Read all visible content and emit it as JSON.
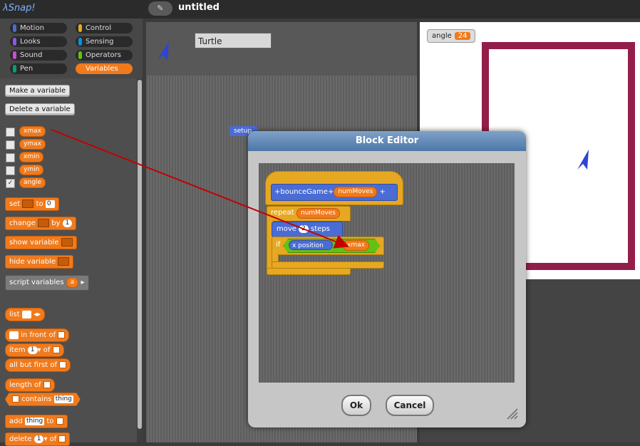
{
  "app": {
    "logo": "λSnap!",
    "project_title": "untitled",
    "cloud_icon": "pencil-icon"
  },
  "categories": [
    {
      "label": "Motion",
      "color": "#4a6cd4"
    },
    {
      "label": "Control",
      "color": "#e6a822"
    },
    {
      "label": "Looks",
      "color": "#8f56e3"
    },
    {
      "label": "Sensing",
      "color": "#0494dc"
    },
    {
      "label": "Sound",
      "color": "#cf4ad9"
    },
    {
      "label": "Operators",
      "color": "#62c213"
    },
    {
      "label": "Pen",
      "color": "#00a178"
    },
    {
      "label": "Variables",
      "color": "#f07a1c"
    }
  ],
  "palette": {
    "make_variable": "Make a variable",
    "delete_variable": "Delete a variable",
    "variables": [
      {
        "name": "xmax",
        "checked": false
      },
      {
        "name": "ymax",
        "checked": false
      },
      {
        "name": "xmin",
        "checked": false
      },
      {
        "name": "ymin",
        "checked": false
      },
      {
        "name": "angle",
        "checked": true
      }
    ],
    "set_label": "set",
    "set_to": "to",
    "set_value": "0",
    "change_label": "change",
    "change_by": "by",
    "change_value": "1",
    "show_variable": "show variable",
    "hide_variable": "hide variable",
    "script_variables": "script variables",
    "script_var_name": "a",
    "list_label": "list",
    "in_front_of": "in front of",
    "item_label": "item",
    "item_value": "1",
    "item_of": "of",
    "all_but_first": "all but first of",
    "length_of": "length of",
    "contains": "contains",
    "contains_value": "thing",
    "add_label": "add",
    "add_value": "thing",
    "add_to": "to",
    "delete_label": "delete",
    "delete_value": "1",
    "delete_of": "of"
  },
  "sprite": {
    "name": "Turtle"
  },
  "script": {
    "setup_block": "setup"
  },
  "stage": {
    "watcher_label": "angle",
    "watcher_value": "24"
  },
  "block_editor": {
    "title": "Block Editor",
    "hat_name": "bounceGame",
    "hat_param": "numMoves",
    "repeat_label": "repeat",
    "repeat_var": "numMoves",
    "move_label": "move",
    "move_value": "2",
    "steps_label": "steps",
    "if_label": "if",
    "x_position": "x position",
    "compare_op": ">",
    "compare_var": "xmax",
    "ok": "Ok",
    "cancel": "Cancel"
  }
}
